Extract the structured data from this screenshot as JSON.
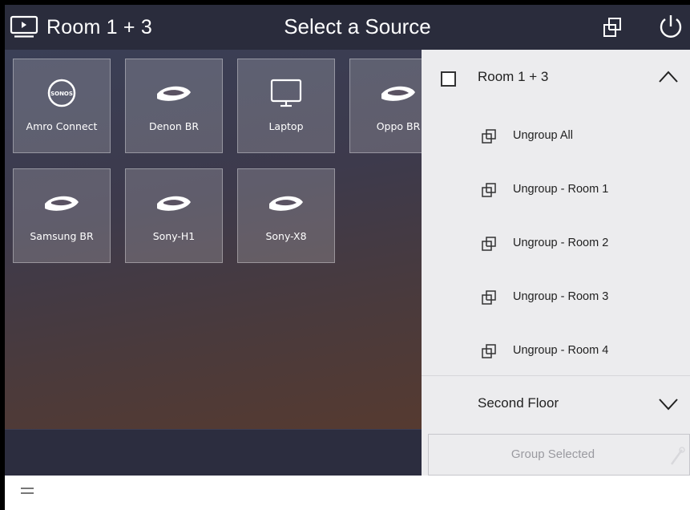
{
  "header": {
    "room_name": "Room 1 + 3",
    "title": "Select a Source",
    "icons": [
      "play-screen-icon",
      "group-icon",
      "power-icon"
    ]
  },
  "sources": [
    {
      "label": "Amro Connect",
      "icon": "sonos-icon"
    },
    {
      "label": "Denon BR",
      "icon": "bluray-icon"
    },
    {
      "label": "Laptop",
      "icon": "monitor-icon"
    },
    {
      "label": "Oppo BR",
      "icon": "bluray-icon"
    },
    {
      "label": "Samsung BR",
      "icon": "bluray-icon"
    },
    {
      "label": "Sony-H1",
      "icon": "bluray-icon"
    },
    {
      "label": "Sony-X8",
      "icon": "bluray-icon"
    }
  ],
  "group_panel": {
    "room": {
      "label": "Room 1 + 3",
      "checked": false,
      "expanded": true
    },
    "ungroup_items": [
      {
        "label": "Ungroup All"
      },
      {
        "label": "Ungroup - Room 1"
      },
      {
        "label": "Ungroup - Room 2"
      },
      {
        "label": "Ungroup - Room 3"
      },
      {
        "label": "Ungroup - Room 4"
      }
    ],
    "floor": {
      "label": "Second Floor",
      "expanded": false
    },
    "group_selected_label": "Group Selected"
  },
  "colors": {
    "topbar": "#2a2c3c",
    "panel": "#ececee",
    "disabled_text": "#9a9aa0"
  }
}
